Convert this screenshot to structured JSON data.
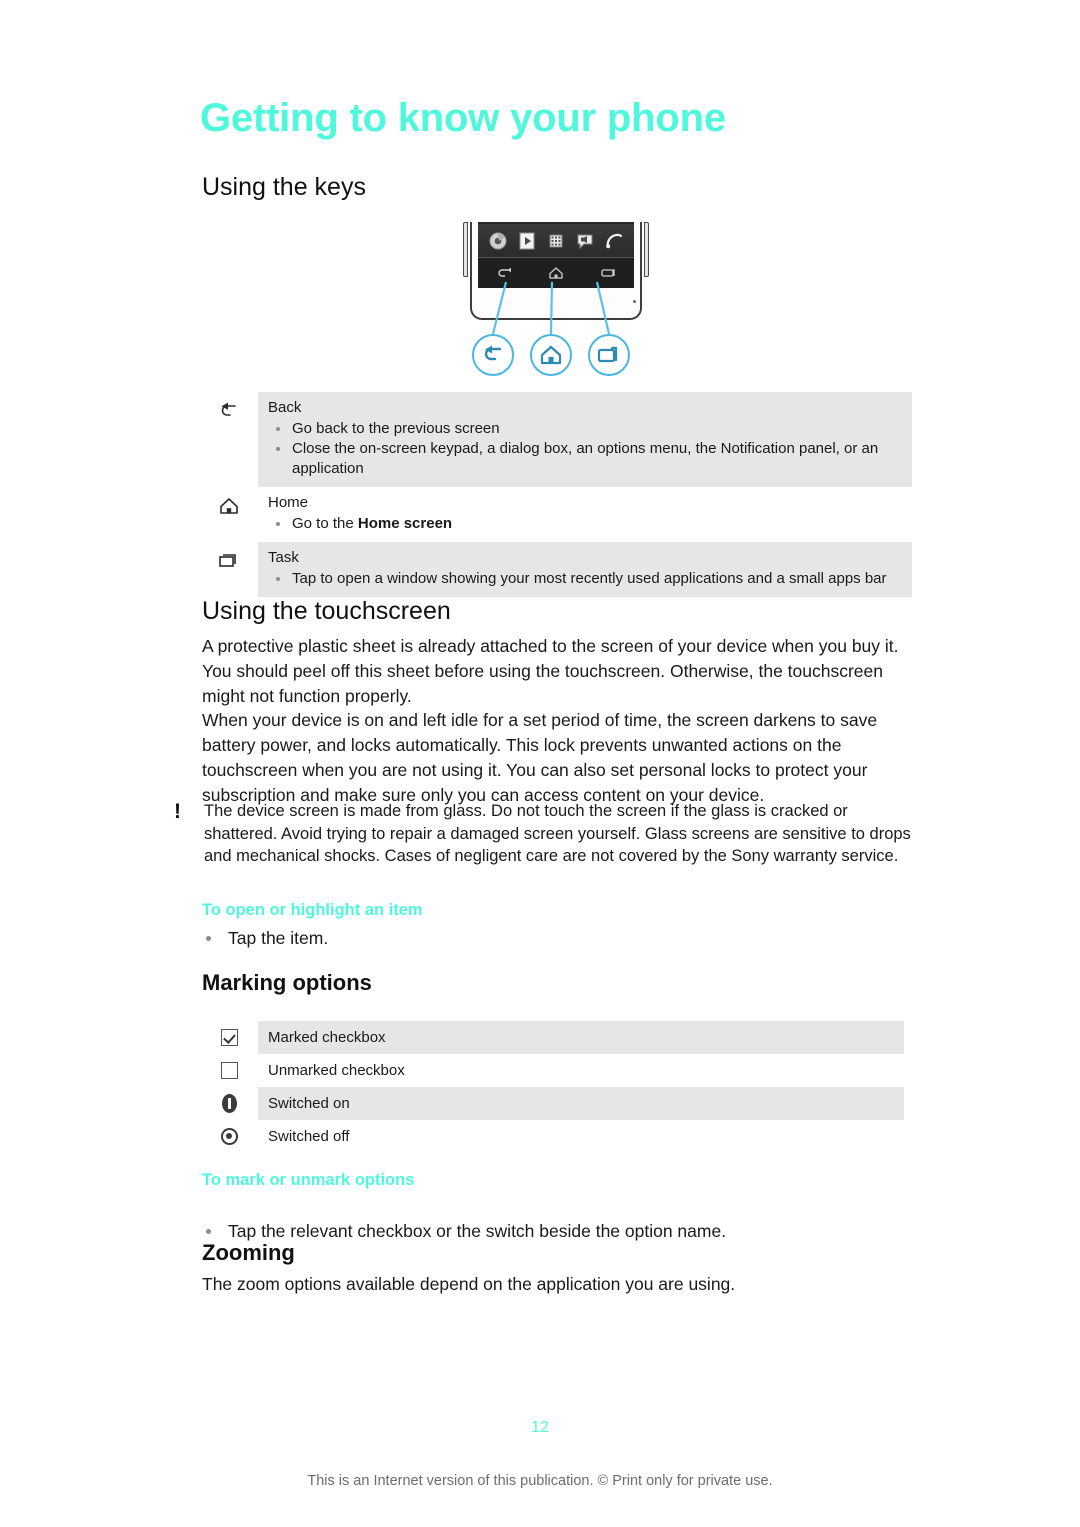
{
  "document": {
    "chapter_title": "Getting to know your phone",
    "page_number": "12",
    "footer_note": "This is an Internet version of this publication. © Print only for private use.",
    "accent_color": "#4FF7DC",
    "callout_color": "#49B6DF",
    "row_shade_color": "#e6e6e6"
  },
  "sections": {
    "using_keys": {
      "heading": "Using the keys",
      "figure": {
        "name": "phone-bottom-illustration",
        "dock_icons": [
          "browser-icon",
          "play-store-icon",
          "app-grid-icon",
          "messaging-icon",
          "phone-icon"
        ],
        "nav_keys": [
          "back-key",
          "home-key",
          "task-key"
        ],
        "callouts": [
          "back-callout",
          "home-callout",
          "task-callout"
        ]
      },
      "table": [
        {
          "icon": "back-arrow-icon",
          "title": "Back",
          "shaded": true,
          "items": [
            {
              "text": "Go back to the previous screen"
            },
            {
              "text": "Close the on-screen keypad, a dialog box, an options menu, the Notification panel, or an application"
            }
          ]
        },
        {
          "icon": "home-icon",
          "title": "Home",
          "shaded": false,
          "items": [
            {
              "prefix": "Go to the ",
              "bold": "Home screen",
              "suffix": ""
            }
          ]
        },
        {
          "icon": "task-icon",
          "title": "Task",
          "shaded": true,
          "items": [
            {
              "text": "Tap to open a window showing your most recently used applications and a small apps bar"
            }
          ]
        }
      ]
    },
    "using_touchscreen": {
      "heading": "Using the touchscreen",
      "paragraph_1": "A protective plastic sheet is already attached to the screen of your device when you buy it. You should peel off this sheet before using the touchscreen. Otherwise, the touchscreen might not function properly.",
      "paragraph_2": "When your device is on and left idle for a set period of time, the screen darkens to save battery power, and locks automatically. This lock prevents unwanted actions on the touchscreen when you are not using it. You can also set personal locks to protect your subscription and make sure only you can access content on your device.",
      "note": {
        "icon": "exclamation-icon",
        "text": "The device screen is made from glass. Do not touch the screen if the glass is cracked or shattered. Avoid trying to repair a damaged screen yourself. Glass screens are sensitive to drops and mechanical shocks. Cases of negligent care are not covered by the Sony warranty service."
      },
      "to_open_heading": "To open or highlight an item",
      "to_open_bullet": "Tap the item."
    },
    "marking_options": {
      "heading": "Marking options",
      "table": [
        {
          "icon": "marked-checkbox-icon",
          "label": "Marked checkbox",
          "shaded": true
        },
        {
          "icon": "unmarked-checkbox-icon",
          "label": "Unmarked checkbox",
          "shaded": false
        },
        {
          "icon": "switch-on-icon",
          "label": "Switched on",
          "shaded": true
        },
        {
          "icon": "switch-off-icon",
          "label": "Switched off",
          "shaded": false
        }
      ],
      "to_mark_heading": "To mark or unmark options",
      "to_mark_bullet": "Tap the relevant checkbox or the switch beside the option name."
    },
    "zooming": {
      "heading": "Zooming",
      "paragraph_1": "The zoom options available depend on the application you are using."
    }
  }
}
